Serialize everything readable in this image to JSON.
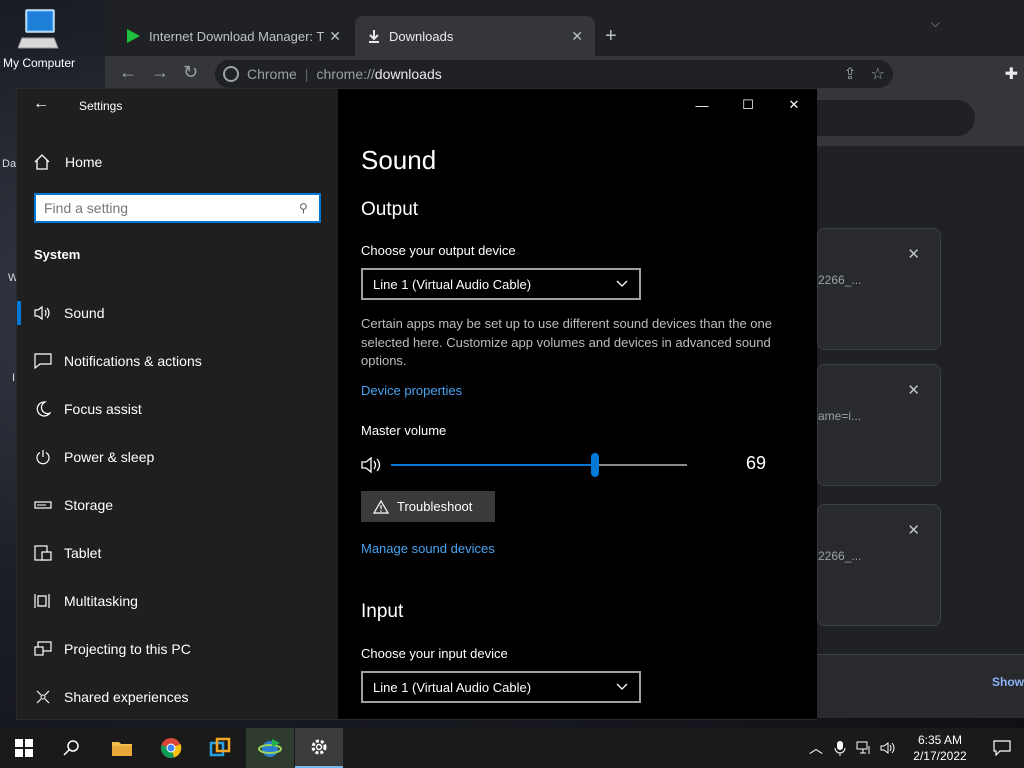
{
  "desktop": {
    "icon_label": "My Computer",
    "fragments": [
      "Da",
      "W",
      "I"
    ]
  },
  "chrome": {
    "tabs": [
      {
        "title": "Internet Download Manager: The",
        "close": "✕"
      },
      {
        "title": "Downloads",
        "close": "✕"
      }
    ],
    "new_tab": "+",
    "omnibox": {
      "site_label": "Chrome",
      "url_scheme": "chrome://",
      "url_path": "downloads"
    },
    "download_cards": [
      {
        "file": "2266_...",
        "close": "✕"
      },
      {
        "file": "ame=i...",
        "close": "✕"
      },
      {
        "file": "2266_...",
        "close": "✕"
      }
    ],
    "show_all": "Show"
  },
  "settings": {
    "app_title": "Settings",
    "home_label": "Home",
    "search_placeholder": "Find a setting",
    "group_label": "System",
    "nav_items": [
      {
        "label": "Sound",
        "icon": "speaker-icon",
        "selected": true
      },
      {
        "label": "Notifications & actions",
        "icon": "notification-icon",
        "selected": false
      },
      {
        "label": "Focus assist",
        "icon": "moon-icon",
        "selected": false
      },
      {
        "label": "Power & sleep",
        "icon": "power-icon",
        "selected": false
      },
      {
        "label": "Storage",
        "icon": "storage-icon",
        "selected": false
      },
      {
        "label": "Tablet",
        "icon": "tablet-icon",
        "selected": false
      },
      {
        "label": "Multitasking",
        "icon": "multitasking-icon",
        "selected": false
      },
      {
        "label": "Projecting to this PC",
        "icon": "projector-icon",
        "selected": false
      },
      {
        "label": "Shared experiences",
        "icon": "shared-icon",
        "selected": false
      }
    ],
    "page_title": "Sound",
    "output": {
      "heading": "Output",
      "device_label": "Choose your output device",
      "device_value": "Line 1 (Virtual Audio Cable)",
      "description": "Certain apps may be set up to use different sound devices than the one selected here. Customize app volumes and devices in advanced sound options.",
      "device_properties_link": "Device properties",
      "volume_label": "Master volume",
      "volume_value": 69,
      "volume_text": "69",
      "troubleshoot_label": "Troubleshoot",
      "manage_link": "Manage sound devices"
    },
    "input": {
      "heading": "Input",
      "device_label": "Choose your input device",
      "device_value": "Line 1 (Virtual Audio Cable)"
    }
  },
  "taskbar": {
    "time": "6:35 AM",
    "date": "2/17/2022"
  },
  "colors": {
    "accent": "#0078d7",
    "link": "#4aa3f0",
    "sidebar_bg": "#1f1f1f"
  }
}
